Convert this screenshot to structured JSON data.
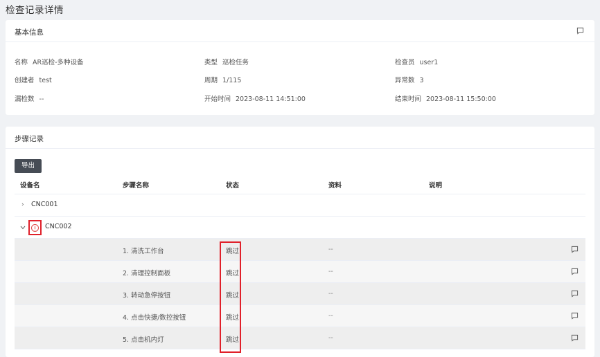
{
  "page": {
    "title": "检查记录详情"
  },
  "basic": {
    "title": "基本信息",
    "fields": [
      {
        "label": "名称",
        "value": "AR巡检-多种设备"
      },
      {
        "label": "类型",
        "value": "巡检任务"
      },
      {
        "label": "检查员",
        "value": "user1"
      },
      {
        "label": "创建者",
        "value": "test"
      },
      {
        "label": "周期",
        "value": "1/115"
      },
      {
        "label": "异常数",
        "value": "3"
      },
      {
        "label": "漏检数",
        "value": "--"
      },
      {
        "label": "开始时间",
        "value": "2023-08-11 14:51:00"
      },
      {
        "label": "结束时间",
        "value": "2023-08-11 15:50:00"
      }
    ]
  },
  "steps": {
    "title": "步骤记录",
    "export_label": "导出",
    "columns": [
      "设备名",
      "步骤名称",
      "状态",
      "资料",
      "说明"
    ],
    "groups": [
      {
        "name": "CNC001",
        "expanded": false,
        "warning": false
      },
      {
        "name": "CNC002",
        "expanded": true,
        "warning": true
      }
    ],
    "rows": [
      {
        "name": "1. 清洗工作台",
        "status": "跳过",
        "data": "--"
      },
      {
        "name": "2. 清理控制面板",
        "status": "跳过",
        "data": "--"
      },
      {
        "name": "3. 转动急停按钮",
        "status": "跳过",
        "data": "--"
      },
      {
        "name": "4. 点击快捷/数控按钮",
        "status": "跳过",
        "data": "--"
      },
      {
        "name": "5. 点击机内灯",
        "status": "跳过",
        "data": "--"
      }
    ]
  },
  "icons": {
    "comment": "comment-icon",
    "expand": "chevron-right-icon",
    "collapse": "chevron-down-icon",
    "warning": "warning-circle-icon"
  },
  "colors": {
    "export_button": "#464c55",
    "highlight": "#e0202a",
    "warning": "#e04848"
  }
}
